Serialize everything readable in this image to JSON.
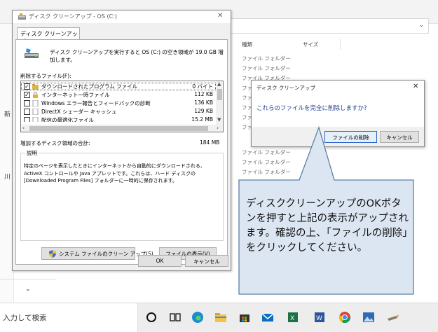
{
  "background_window": {
    "column_type": "種類",
    "column_size": "サイズ",
    "rows": [
      "ファイル フォルダー",
      "ファイル フォルダー",
      "ファイル フォルダー",
      "ファイル フォルダー",
      "ファイル フォルダー",
      "ファイル フォルダー",
      "ファイル フォルダー",
      "ファイル フォルダー",
      "ファイル フォルダー",
      "ファイル フォルダー",
      "ファイル フォルダー"
    ],
    "edge_glyph_1": "新",
    "edge_glyph_2": "川"
  },
  "cleanup_dialog": {
    "title": "ディスク クリーンアップ - OS (C:)",
    "tab_label": "ディスク クリーンアップ",
    "intro_text": "ディスク クリーンアップを実行すると OS (C:) の空き領域が 19.0 GB 増加します。",
    "files_to_delete_label": "削除するファイル(F):",
    "files": [
      {
        "checked": true,
        "name": "ダウンロードされたプログラム ファイル",
        "size": "0 バイト",
        "icon": "folder-icon"
      },
      {
        "checked": true,
        "name": "インターネット一時ファイル",
        "size": "112 KB",
        "icon": "lock-icon"
      },
      {
        "checked": false,
        "name": "Windows エラー報告とフィードバックの診断",
        "size": "136 KB",
        "icon": "document-icon"
      },
      {
        "checked": false,
        "name": "DirectX シェーダー キャッシュ",
        "size": "129 KB",
        "icon": "document-icon"
      },
      {
        "checked": false,
        "name": "配信の最適化ファイル",
        "size": "15.2 MB",
        "icon": "document-icon"
      }
    ],
    "total_label": "増加するディスク領域の合計:",
    "total_value": "184 MB",
    "description_label": "説明",
    "description_text": "特定のページを表示したときにインターネットから自動的にダウンロードされる、ActiveX コントロールや Java アプレットです。これらは、ハード ディスクの [Downloaded Program Files] フォルダーに一時的に保存されます。",
    "cleanup_system_button": "システム ファイルのクリーン アップ(S)",
    "view_files_button": "ファイルの表示(V)",
    "ok_button": "OK",
    "cancel_button": "キャンセル"
  },
  "confirm_dialog": {
    "title": "ディスク クリーンアップ",
    "message": "これらのファイルを完全に削除しますか?",
    "delete_button": "ファイルの削除",
    "cancel_button": "キャンセル"
  },
  "callout": {
    "text": "ディスククリーンアップのOKボタンを押すと上記の表示がアップされます。確認の上、「ファイルの削除」をクリックしてください。"
  },
  "taskbar": {
    "search_text": "入力して検索",
    "icons": [
      "cortana-icon",
      "task-view-icon",
      "edge-icon",
      "file-explorer-icon",
      "store-icon",
      "mail-icon",
      "excel-icon",
      "word-icon",
      "chrome-icon",
      "photos-icon",
      "app-icon"
    ]
  },
  "colors": {
    "accent": "#2a62c9",
    "confirm_message": "#1f3f8f",
    "callout_fill": "#dce6f2",
    "callout_border": "#5b7fa6"
  }
}
